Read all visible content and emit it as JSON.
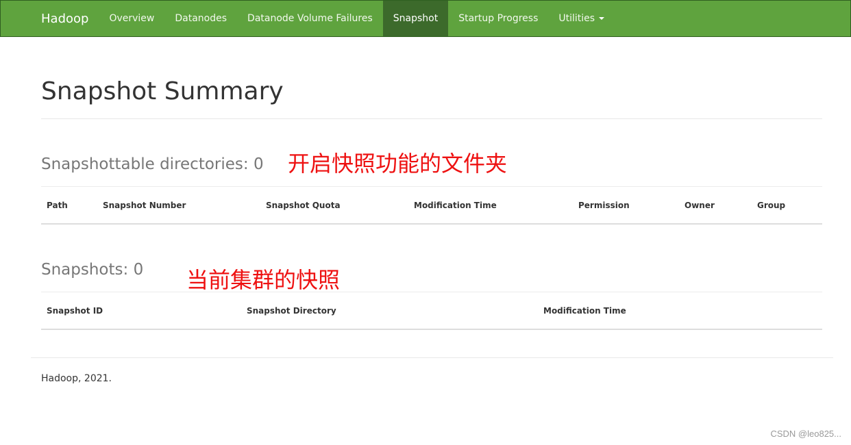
{
  "navbar": {
    "brand": "Hadoop",
    "items": [
      {
        "label": "Overview",
        "active": false
      },
      {
        "label": "Datanodes",
        "active": false
      },
      {
        "label": "Datanode Volume Failures",
        "active": false
      },
      {
        "label": "Snapshot",
        "active": true
      },
      {
        "label": "Startup Progress",
        "active": false
      },
      {
        "label": "Utilities",
        "active": false,
        "has_dropdown": true
      }
    ],
    "colors": {
      "background": "#5fa33e",
      "active": "#3c6a2b"
    }
  },
  "page": {
    "title": "Snapshot Summary"
  },
  "snapshottable": {
    "heading": "Snapshottable directories: 0",
    "annotation": "开启快照功能的文件夹",
    "columns": [
      "Path",
      "Snapshot Number",
      "Snapshot Quota",
      "Modification Time",
      "Permission",
      "Owner",
      "Group"
    ]
  },
  "snapshots": {
    "heading": "Snapshots: 0",
    "annotation": "当前集群的快照",
    "columns": [
      "Snapshot ID",
      "Snapshot Directory",
      "Modification Time"
    ]
  },
  "footer": {
    "text": "Hadoop, 2021."
  },
  "watermark": "CSDN @leo825..."
}
